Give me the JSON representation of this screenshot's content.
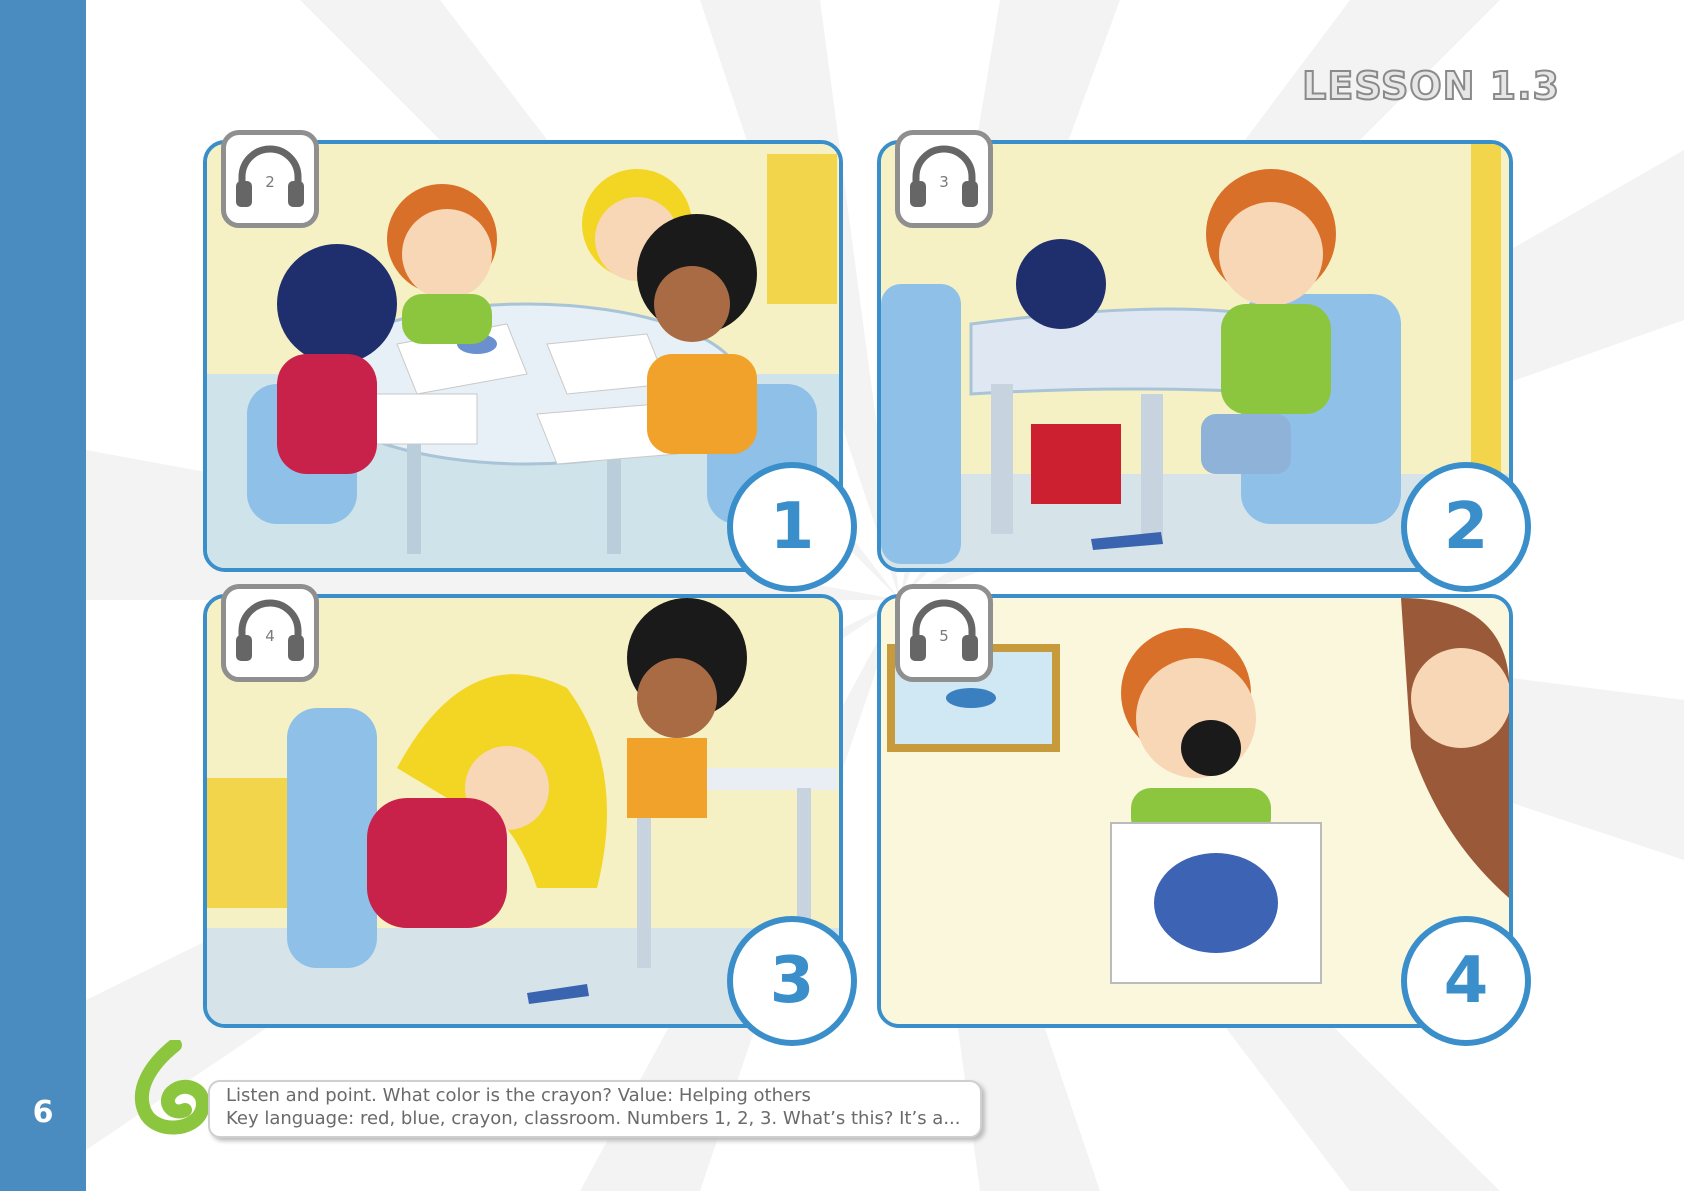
{
  "page": {
    "lesson_title": "LESSON 1.3",
    "page_number": "6"
  },
  "panels": [
    {
      "number": "1",
      "track": "2"
    },
    {
      "number": "2",
      "track": "3"
    },
    {
      "number": "3",
      "track": "4"
    },
    {
      "number": "4",
      "track": "5"
    }
  ],
  "footer": {
    "line1": "Listen and point. What color is the crayon? Value: Helping others",
    "line2": "Key language: red, blue, crayon, classroom. Numbers 1, 2, 3. What’s this? It’s a..."
  },
  "colors": {
    "sidebar": "#4a8cbf",
    "panel_border": "#3a8fcb",
    "logo_green": "#8cc63f"
  }
}
